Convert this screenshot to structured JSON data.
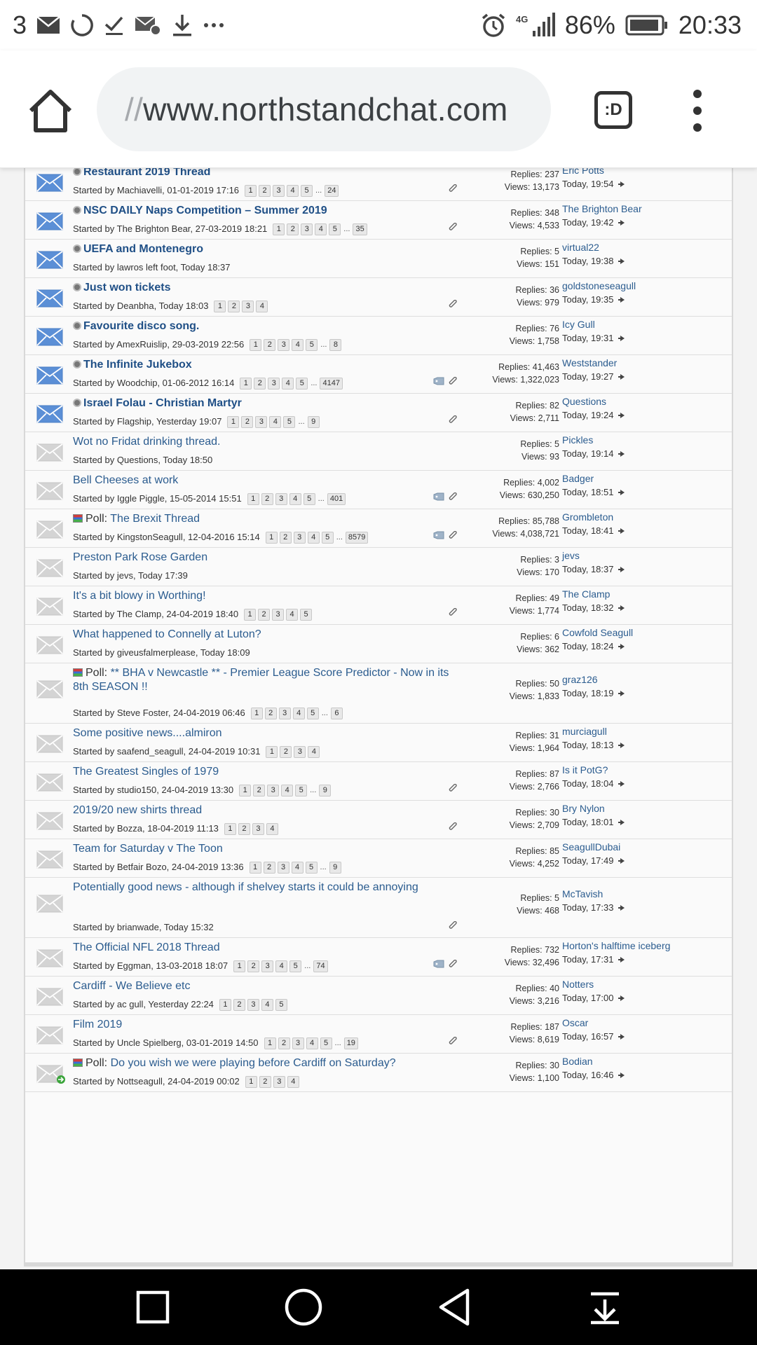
{
  "status_bar": {
    "notification_count": "3",
    "battery": "86%",
    "network": "4G",
    "time": "20:33"
  },
  "browser": {
    "url_prefix": "//",
    "url": "www.northstandchat.com",
    "tab_label": ":D"
  },
  "threads": [
    {
      "title": "Restaurant 2019 Thread",
      "new": true,
      "poll": false,
      "starter": "Started by Machiavelli, 01-01-2019 17:16",
      "pages": [
        "1",
        "2",
        "3",
        "4",
        "5"
      ],
      "last_page": "24",
      "ellipsis": true,
      "attach": true,
      "tag": false,
      "replies": "Replies: 237",
      "views": "Views: 13,173",
      "last_user": "Eric Potts",
      "last_time": "Today, 19:54"
    },
    {
      "title": "NSC DAILY Naps Competition – Summer 2019",
      "new": true,
      "poll": false,
      "starter": "Started by The Brighton Bear, 27-03-2019 18:21",
      "pages": [
        "1",
        "2",
        "3",
        "4",
        "5"
      ],
      "last_page": "35",
      "ellipsis": true,
      "attach": true,
      "tag": false,
      "replies": "Replies: 348",
      "views": "Views: 4,533",
      "last_user": "The Brighton Bear",
      "last_time": "Today, 19:42"
    },
    {
      "title": "UEFA and Montenegro",
      "new": true,
      "poll": false,
      "starter": "Started by lawros left foot, Today 18:37",
      "pages": [],
      "last_page": "",
      "ellipsis": false,
      "attach": false,
      "tag": false,
      "replies": "Replies: 5",
      "views": "Views: 151",
      "last_user": "virtual22",
      "last_time": "Today, 19:38"
    },
    {
      "title": "Just won tickets",
      "new": true,
      "poll": false,
      "starter": "Started by Deanbha, Today 18:03",
      "pages": [
        "1",
        "2",
        "3",
        "4"
      ],
      "last_page": "",
      "ellipsis": false,
      "attach": true,
      "tag": false,
      "replies": "Replies: 36",
      "views": "Views: 979",
      "last_user": "goldstoneseagull",
      "last_time": "Today, 19:35"
    },
    {
      "title": "Favourite disco song.",
      "new": true,
      "poll": false,
      "starter": "Started by AmexRuislip, 29-03-2019 22:56",
      "pages": [
        "1",
        "2",
        "3",
        "4",
        "5"
      ],
      "last_page": "8",
      "ellipsis": true,
      "attach": false,
      "tag": false,
      "replies": "Replies: 76",
      "views": "Views: 1,758",
      "last_user": "Icy Gull",
      "last_time": "Today, 19:31"
    },
    {
      "title": "The Infinite Jukebox",
      "new": true,
      "poll": false,
      "starter": "Started by Woodchip, 01-06-2012 16:14",
      "pages": [
        "1",
        "2",
        "3",
        "4",
        "5"
      ],
      "last_page": "4147",
      "ellipsis": true,
      "attach": true,
      "tag": true,
      "replies": "Replies: 41,463",
      "views": "Views: 1,322,023",
      "last_user": "Weststander",
      "last_time": "Today, 19:27"
    },
    {
      "title": "Israel Folau - Christian Martyr",
      "new": true,
      "poll": false,
      "starter": "Started by Flagship, Yesterday 19:07",
      "pages": [
        "1",
        "2",
        "3",
        "4",
        "5"
      ],
      "last_page": "9",
      "ellipsis": true,
      "attach": true,
      "tag": false,
      "replies": "Replies: 82",
      "views": "Views: 2,711",
      "last_user": "Questions",
      "last_time": "Today, 19:24"
    },
    {
      "title": "Wot no Fridat drinking thread.",
      "new": false,
      "poll": false,
      "starter": "Started by Questions, Today 18:50",
      "pages": [],
      "last_page": "",
      "ellipsis": false,
      "attach": false,
      "tag": false,
      "replies": "Replies: 5",
      "views": "Views: 93",
      "last_user": "Pickles",
      "last_time": "Today, 19:14"
    },
    {
      "title": "Bell Cheeses at work",
      "new": false,
      "poll": false,
      "starter": "Started by Iggle Piggle, 15-05-2014 15:51",
      "pages": [
        "1",
        "2",
        "3",
        "4",
        "5"
      ],
      "last_page": "401",
      "ellipsis": true,
      "attach": true,
      "tag": true,
      "replies": "Replies: 4,002",
      "views": "Views: 630,250",
      "last_user": "Badger",
      "last_time": "Today, 18:51"
    },
    {
      "title": "The Brexit Thread",
      "new": false,
      "poll": true,
      "poll_label": "Poll:",
      "starter": "Started by KingstonSeagull, 12-04-2016 15:14",
      "pages": [
        "1",
        "2",
        "3",
        "4",
        "5"
      ],
      "last_page": "8579",
      "ellipsis": true,
      "attach": true,
      "tag": true,
      "replies": "Replies: 85,788",
      "views": "Views: 4,038,721",
      "last_user": "Grombleton",
      "last_time": "Today, 18:41"
    },
    {
      "title": "Preston Park Rose Garden",
      "new": false,
      "poll": false,
      "starter": "Started by jevs, Today 17:39",
      "pages": [],
      "last_page": "",
      "ellipsis": false,
      "attach": false,
      "tag": false,
      "replies": "Replies: 3",
      "views": "Views: 170",
      "last_user": "jevs",
      "last_time": "Today, 18:37"
    },
    {
      "title": "It's a bit blowy in Worthing!",
      "new": false,
      "poll": false,
      "starter": "Started by The Clamp, 24-04-2019 18:40",
      "pages": [
        "1",
        "2",
        "3",
        "4",
        "5"
      ],
      "last_page": "",
      "ellipsis": false,
      "attach": true,
      "tag": false,
      "replies": "Replies: 49",
      "views": "Views: 1,774",
      "last_user": "The Clamp",
      "last_time": "Today, 18:32"
    },
    {
      "title": "What happened to Connelly at Luton?",
      "new": false,
      "poll": false,
      "starter": "Started by giveusfalmerplease, Today 18:09",
      "pages": [],
      "last_page": "",
      "ellipsis": false,
      "attach": false,
      "tag": false,
      "replies": "Replies: 6",
      "views": "Views: 362",
      "last_user": "Cowfold Seagull",
      "last_time": "Today, 18:24"
    },
    {
      "title": "** BHA v Newcastle ** - Premier League Score Predictor - Now in its 8th SEASON !!",
      "new": false,
      "poll": true,
      "poll_label": "Poll:",
      "starter": "Started by Steve Foster, 24-04-2019 06:46",
      "pages": [
        "1",
        "2",
        "3",
        "4",
        "5"
      ],
      "last_page": "6",
      "ellipsis": true,
      "attach": false,
      "tag": false,
      "replies": "Replies: 50",
      "views": "Views: 1,833",
      "last_user": "graz126",
      "last_time": "Today, 18:19"
    },
    {
      "title": "Some positive news....almiron",
      "new": false,
      "poll": false,
      "starter": "Started by saafend_seagull, 24-04-2019 10:31",
      "pages": [
        "1",
        "2",
        "3",
        "4"
      ],
      "last_page": "",
      "ellipsis": false,
      "attach": false,
      "tag": false,
      "replies": "Replies: 31",
      "views": "Views: 1,964",
      "last_user": "murciagull",
      "last_time": "Today, 18:13"
    },
    {
      "title": "The Greatest Singles of 1979",
      "new": false,
      "poll": false,
      "starter": "Started by studio150, 24-04-2019 13:30",
      "pages": [
        "1",
        "2",
        "3",
        "4",
        "5"
      ],
      "last_page": "9",
      "ellipsis": true,
      "attach": true,
      "tag": false,
      "replies": "Replies: 87",
      "views": "Views: 2,766",
      "last_user": "Is it PotG?",
      "last_time": "Today, 18:04"
    },
    {
      "title": "2019/20 new shirts thread",
      "new": false,
      "poll": false,
      "starter": "Started by Bozza, 18-04-2019 11:13",
      "pages": [
        "1",
        "2",
        "3",
        "4"
      ],
      "last_page": "",
      "ellipsis": false,
      "attach": true,
      "tag": false,
      "replies": "Replies: 30",
      "views": "Views: 2,709",
      "last_user": "Bry Nylon",
      "last_time": "Today, 18:01"
    },
    {
      "title": "Team for Saturday v The Toon",
      "new": false,
      "poll": false,
      "starter": "Started by Betfair Bozo, 24-04-2019 13:36",
      "pages": [
        "1",
        "2",
        "3",
        "4",
        "5"
      ],
      "last_page": "9",
      "ellipsis": true,
      "attach": false,
      "tag": false,
      "replies": "Replies: 85",
      "views": "Views: 4,252",
      "last_user": "SeagullDubai",
      "last_time": "Today, 17:49"
    },
    {
      "title": "Potentially good news - although if shelvey starts it could be annoying",
      "new": false,
      "poll": false,
      "starter": "Started by brianwade, Today 15:32",
      "pages": [],
      "last_page": "",
      "ellipsis": false,
      "attach": true,
      "tag": false,
      "replies": "Replies: 5",
      "views": "Views: 468",
      "last_user": "McTavish",
      "last_time": "Today, 17:33"
    },
    {
      "title": "The Official NFL 2018 Thread",
      "new": false,
      "poll": false,
      "starter": "Started by Eggman, 13-03-2018 18:07",
      "pages": [
        "1",
        "2",
        "3",
        "4",
        "5"
      ],
      "last_page": "74",
      "ellipsis": true,
      "attach": true,
      "tag": true,
      "replies": "Replies: 732",
      "views": "Views: 32,496",
      "last_user": "Horton's halftime iceberg",
      "last_time": "Today, 17:31"
    },
    {
      "title": "Cardiff - We Believe etc",
      "new": false,
      "poll": false,
      "starter": "Started by ac gull, Yesterday 22:24",
      "pages": [
        "1",
        "2",
        "3",
        "4",
        "5"
      ],
      "last_page": "",
      "ellipsis": false,
      "attach": false,
      "tag": false,
      "replies": "Replies: 40",
      "views": "Views: 3,216",
      "last_user": "Notters",
      "last_time": "Today, 17:00"
    },
    {
      "title": "Film 2019",
      "new": false,
      "poll": false,
      "starter": "Started by Uncle Spielberg, 03-01-2019 14:50",
      "pages": [
        "1",
        "2",
        "3",
        "4",
        "5"
      ],
      "last_page": "19",
      "ellipsis": true,
      "attach": true,
      "tag": false,
      "replies": "Replies: 187",
      "views": "Views: 8,619",
      "last_user": "Oscar",
      "last_time": "Today, 16:57"
    },
    {
      "title": "Do you wish we were playing before Cardiff on Saturday?",
      "new": false,
      "poll": true,
      "poll_label": "Poll:",
      "subscribed": true,
      "starter": "Started by Nottseagull, 24-04-2019 00:02",
      "pages": [
        "1",
        "2",
        "3",
        "4"
      ],
      "last_page": "",
      "ellipsis": false,
      "attach": false,
      "tag": false,
      "replies": "Replies: 30",
      "views": "Views: 1,100",
      "last_user": "Bodian",
      "last_time": "Today, 16:46"
    }
  ],
  "colors": {
    "link": "#2b5c8f",
    "new_link": "#1f4f86",
    "new_icon": "#5b8fd6",
    "read_icon": "#d4d4d4"
  }
}
